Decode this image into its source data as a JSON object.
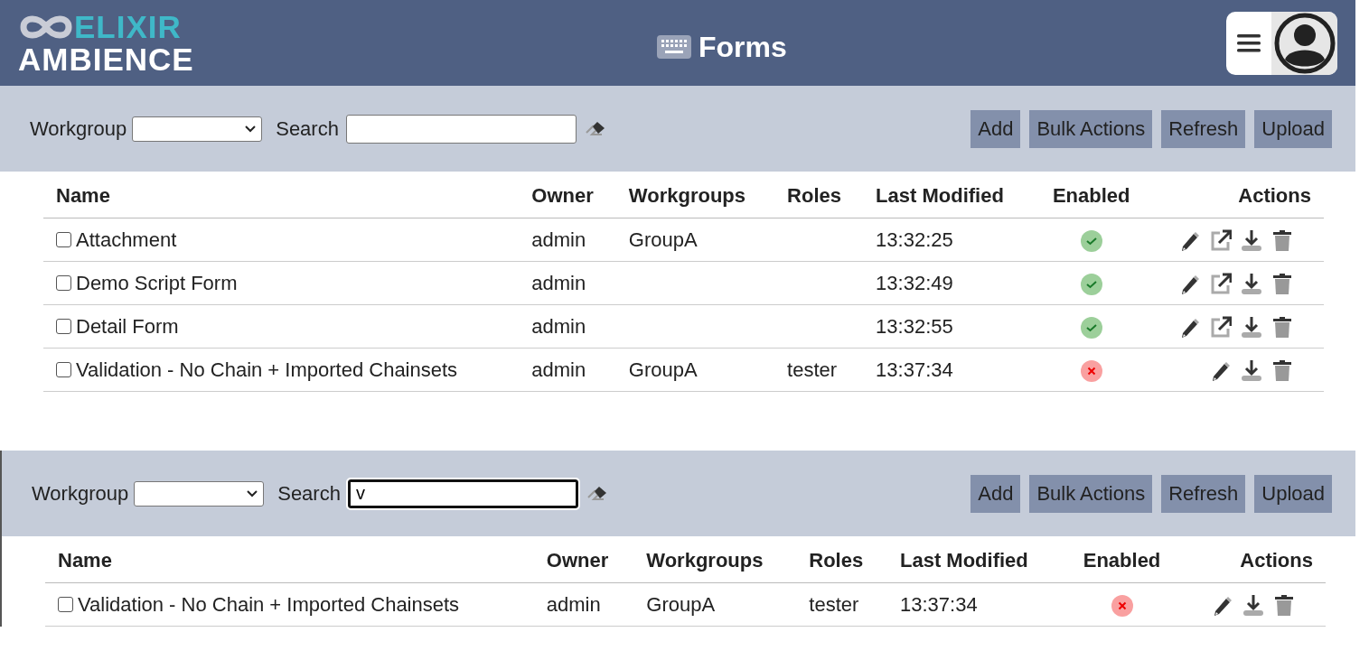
{
  "header": {
    "logo_top": "ELIXIR",
    "logo_bottom": "AMBIENCE",
    "title": "Forms"
  },
  "panels": [
    {
      "workgroup_label": "Workgroup",
      "search_label": "Search",
      "search_focused": false,
      "buttons": [
        "Add",
        "Bulk Actions",
        "Refresh",
        "Upload"
      ],
      "columns": [
        "Name",
        "Owner",
        "Workgroups",
        "Roles",
        "Last Modified",
        "Enabled",
        "Actions"
      ],
      "rows": [
        {
          "name": "Attachment",
          "checked": false,
          "owner": "admin",
          "workgroups": "GroupA",
          "roles": "",
          "modified": "13:32:25",
          "enabled": true,
          "openable": true
        },
        {
          "name": "Demo Script Form",
          "checked": false,
          "owner": "admin",
          "workgroups": "",
          "roles": "",
          "modified": "13:32:49",
          "enabled": true,
          "openable": true
        },
        {
          "name": "Detail Form",
          "checked": false,
          "owner": "admin",
          "workgroups": "",
          "roles": "",
          "modified": "13:32:55",
          "enabled": true,
          "openable": true
        },
        {
          "name": "Validation - No Chain + Imported Chainsets",
          "checked": false,
          "owner": "admin",
          "workgroups": "GroupA",
          "roles": "tester",
          "modified": "13:37:34",
          "enabled": false,
          "openable": false
        }
      ]
    },
    {
      "workgroup_label": "Workgroup",
      "search_label": "Search",
      "search_value": "v",
      "search_focused": true,
      "buttons": [
        "Add",
        "Bulk Actions",
        "Refresh",
        "Upload"
      ],
      "columns": [
        "Name",
        "Owner",
        "Workgroups",
        "Roles",
        "Last Modified",
        "Enabled",
        "Actions"
      ],
      "rows": [
        {
          "name": "Validation - No Chain + Imported Chainsets",
          "checked": false,
          "owner": "admin",
          "workgroups": "GroupA",
          "roles": "tester",
          "modified": "13:37:34",
          "enabled": false,
          "openable": false
        }
      ]
    }
  ]
}
